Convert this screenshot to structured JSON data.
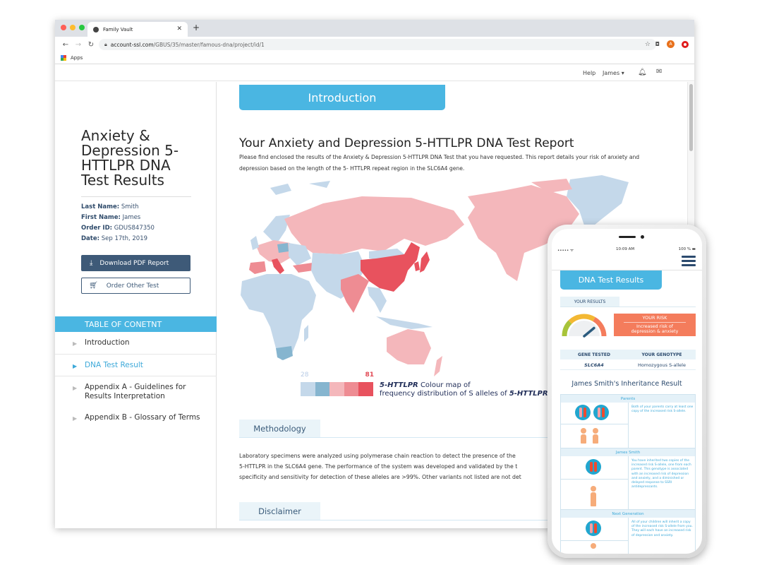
{
  "browser": {
    "tab_title": "Family Vault",
    "url_domain": "account-ssl.com",
    "url_path": "/GBUS/35/master/famous-dna/project/id/1",
    "bookmark_apps": "Apps",
    "ext_badge": "A",
    "window_dots": [
      "#ff5f57",
      "#febc2e",
      "#28c840"
    ]
  },
  "topbar": {
    "help": "Help",
    "user": "James ▾"
  },
  "sidebar": {
    "title": "Anxiety & Depression 5-HTTLPR DNA Test Results",
    "info": [
      {
        "label": "Last Name:",
        "value": "Smith"
      },
      {
        "label": "First Name:",
        "value": "James"
      },
      {
        "label": "Order ID:",
        "value": "GDUS847350"
      },
      {
        "label": "Date:",
        "value": "Sep 17th, 2019"
      }
    ],
    "download_button": "Download PDF Report",
    "order_button": "Order Other Test",
    "toc_header": "TABLE OF CONETNT",
    "toc": [
      {
        "label": "Introduction",
        "active": false
      },
      {
        "label": "DNA Test Result",
        "active": true
      },
      {
        "label": "Appendix A - Guidelines for Results Interpretation",
        "active": false
      },
      {
        "label": "Appendix B - Glossary of Terms",
        "active": false
      }
    ]
  },
  "main": {
    "intro_button": "Introduction",
    "report_title": "Your Anxiety and Depression 5-HTTLPR DNA Test Report",
    "report_paragraph": "Please find enclosed the results of the Anxiety & Depression 5-HTTLPR DNA Test that you have requested. This report details your risk of anxiety and depression based on the length of the 5- HTTLPR repeat region in the SLC6A4 gene.",
    "map": {
      "legend_min": "28",
      "legend_max": "81",
      "legend_colors": [
        "#c4d8ea",
        "#86b5cf",
        "#f4b7bb",
        "#ee8c93",
        "#e8525e"
      ],
      "caption_italic": "5-HTTLPR",
      "caption_line1": " Colour map of",
      "caption_line2": "frequency distribution of S alleles of ",
      "caption_italic2": "5-HTTLPR",
      "caption_end": "."
    },
    "methodology_tab": "Methodology",
    "methodology_lines": [
      "Laboratory specimens were analyzed using polymerase chain reaction to detect the presence of the",
      "5-HTTLPR in the SLC6A4 gene. The performance of the system was developed and validated by the t",
      "specificity and sensitivity for detection of these alleles are >99%. Other variants not listed are not det"
    ],
    "disclaimer_tab": "Disclaimer"
  },
  "phone": {
    "signal": "••••• ᯤ",
    "time": "10:09 AM",
    "battery": "100 % ▬",
    "title": "DNA Test Results",
    "your_results": "YOUR RESULTS",
    "risk_label": "YOUR RISK",
    "risk_value_line1": "Increased risk of",
    "risk_value_line2": "depression & anxiety",
    "gauge_level": 0.78,
    "gene_headers": [
      "GENE TESTED",
      "YOUR GENOTYPE"
    ],
    "gene_values": [
      "SLC6A4",
      "Homozygous S-allele"
    ],
    "inheritance_title": "James Smith's Inheritance Result",
    "blocks": [
      {
        "heading": "Parents",
        "text": "Both of your parents carry at least one copy of the increased risk S-allele."
      },
      {
        "heading": "James Smith",
        "text": "You have inherited two copies of the increased risk S-allele, one from each parent. This genotype is associated with an increased risk of depression and anxiety, and a diminished or delayed response to SSRI antidepressants."
      },
      {
        "heading": "Next Generation",
        "text": "All of your children will inherit a copy of the increased risk S-allele from you. They will each have an increased risk of depression and anxiety."
      }
    ]
  }
}
